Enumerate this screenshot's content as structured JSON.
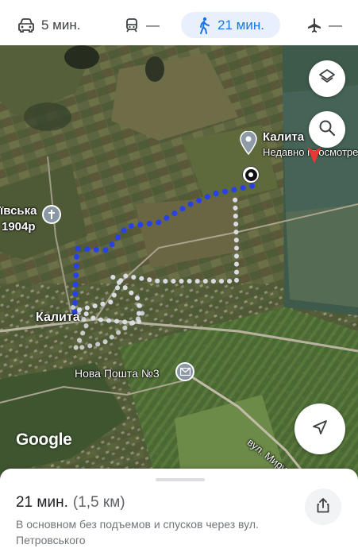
{
  "modes": {
    "car": {
      "icon": "car-icon",
      "label": "5 мин."
    },
    "transit": {
      "icon": "train-icon",
      "label": "—"
    },
    "walk": {
      "icon": "walk-icon",
      "label": "21 мин."
    },
    "flight": {
      "icon": "plane-icon",
      "label": "—"
    }
  },
  "map": {
    "labels": {
      "church": "ївська",
      "church_year": "1904р",
      "destination": "Калита",
      "destination_sub": "Недавно просмотре",
      "origin_town": "Калита",
      "post_office": "Нова Пошта №3",
      "street": "вул. Миру"
    },
    "attribution": "Google",
    "route_color": "#2741e8",
    "alt_route_color": "#c8d4e0"
  },
  "sheet": {
    "duration": "21 мин.",
    "distance": "(1,5 км)",
    "description": "В основном без подъемов и спусков через вул. Петровського"
  },
  "colors": {
    "accent": "#1a73e8",
    "active_mode_bg": "#e8f0fe"
  }
}
